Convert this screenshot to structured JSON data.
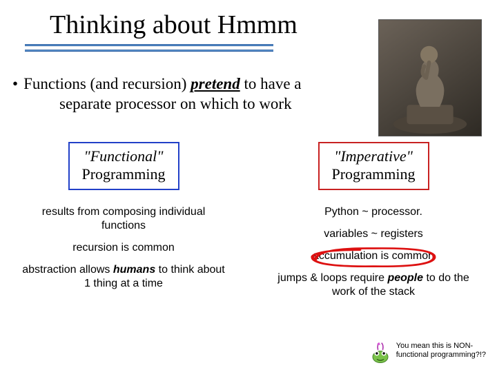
{
  "title": "Thinking about Hmmm",
  "image_alt": "The Thinker statue",
  "bullet": {
    "prefix": "Functions (and recursion) ",
    "emph": "pretend",
    "mid": " to have a",
    "line2": "separate processor on which to work"
  },
  "left": {
    "box_style": "\"Functional\"",
    "box_word": "Programming",
    "n1": "results from composing individual functions",
    "n2": "recursion is common",
    "n3a": "abstraction allows ",
    "n3b": "humans",
    "n3c": " to think about 1 thing at a time"
  },
  "right": {
    "box_style": "\"Imperative\"",
    "box_word": "Programming",
    "n1": "Python ~ processor.",
    "n2": "variables ~ registers",
    "n3": "accumulation is common",
    "n4a": "jumps & loops require ",
    "n4b": "people",
    "n4c": " to do the work of the stack"
  },
  "footer": {
    "line1": "You mean this is NON-",
    "line2": "functional programming?!?"
  }
}
